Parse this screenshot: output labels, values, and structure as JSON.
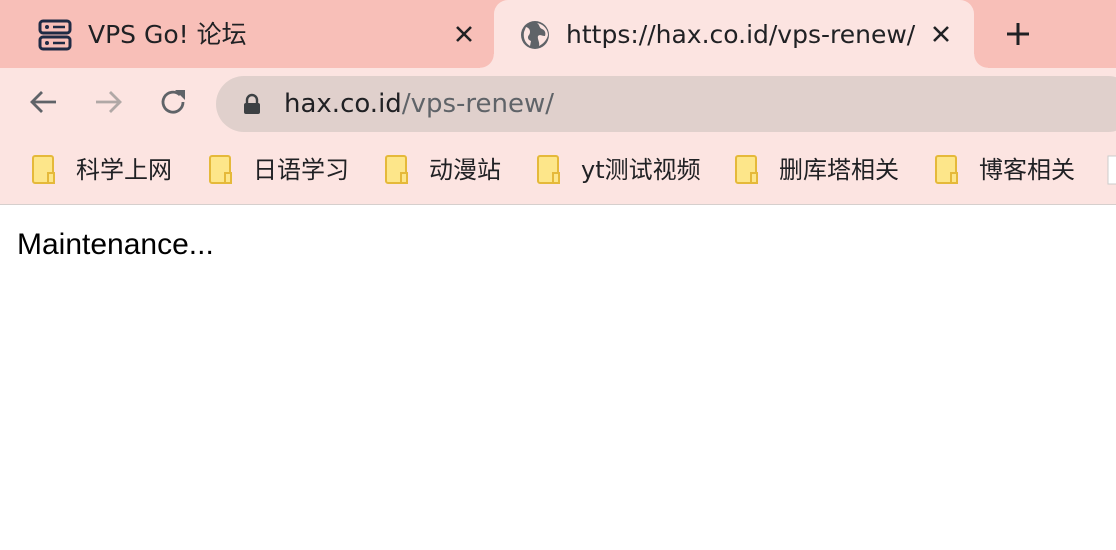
{
  "tabs": [
    {
      "title": "VPS Go! 论坛",
      "icon": "server-icon",
      "active": false
    },
    {
      "title": "https://hax.co.id/vps-renew/",
      "icon": "globe-icon",
      "active": true
    }
  ],
  "toolbar": {
    "url_host": "hax.co.id",
    "url_path": "/vps-renew/"
  },
  "bookmarks": [
    {
      "label": "科学上网"
    },
    {
      "label": "日语学习"
    },
    {
      "label": "动漫站"
    },
    {
      "label": "yt测试视频"
    },
    {
      "label": "删库塔相关"
    },
    {
      "label": "博客相关"
    }
  ],
  "page": {
    "text": "Maintenance..."
  },
  "colors": {
    "tab_strip": "#f8bfb8",
    "active_tab": "#fce4e1",
    "omnibox": "#e0d0cc",
    "folder": "#fde68a"
  }
}
